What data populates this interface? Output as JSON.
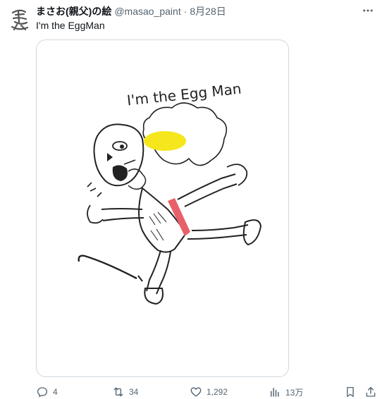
{
  "post": {
    "display_name": "まさお(親父)の絵",
    "handle": "@masao_paint",
    "separator": "·",
    "date": "8月28日",
    "text": "I'm the EggMan"
  },
  "artwork": {
    "caption": "I'm the Egg Man"
  },
  "actions": {
    "reply_count": "4",
    "repost_count": "34",
    "like_count": "1,292",
    "view_count": "13万"
  },
  "icons": {
    "more": "more-horizontal-icon",
    "reply": "reply-icon",
    "repost": "repost-icon",
    "like": "heart-icon",
    "views": "bar-chart-icon",
    "bookmark": "bookmark-icon",
    "share": "share-icon"
  },
  "colors": {
    "text": "#0f1419",
    "secondary": "#536471",
    "border": "#cfd9de",
    "yolk": "#f5e71c",
    "tie": "#e8606a"
  }
}
